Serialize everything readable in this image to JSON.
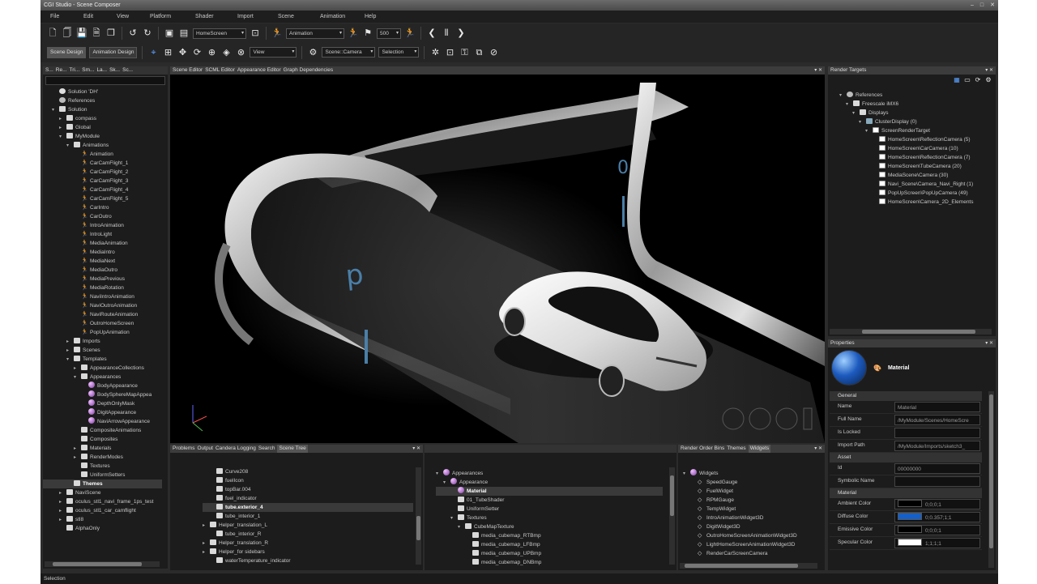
{
  "window": {
    "title": "CGI Studio - Scene Composer",
    "controls": [
      "–",
      "□",
      "✕"
    ]
  },
  "menu": [
    "File",
    "Edit",
    "View",
    "Platform",
    "Shader",
    "Import",
    "Scene",
    "Animation",
    "Help"
  ],
  "toolbar1": {
    "scene_select": "HomeScreen",
    "animation_select": "Animation",
    "speed_value": "500"
  },
  "toolbar2": {
    "tab_scene_design": "Scene Design",
    "tab_animation_design": "Animation Design",
    "view_select": "View",
    "camera_select": "Scene::Camera",
    "selection_select": "Selection"
  },
  "left_tabs": [
    "S...",
    "Re...",
    "Tri...",
    "Sm...",
    "La...",
    "Sk...",
    "Sc..."
  ],
  "solution_tree": [
    {
      "d": 1,
      "t": "",
      "i": "sol",
      "l": "Solution 'DH'"
    },
    {
      "d": 1,
      "t": "",
      "i": "ref",
      "l": "References"
    },
    {
      "d": 1,
      "t": "▾",
      "i": "sq",
      "l": "Solution"
    },
    {
      "d": 2,
      "t": "▸",
      "i": "sq",
      "l": "compass"
    },
    {
      "d": 2,
      "t": "▸",
      "i": "sq",
      "l": "Global"
    },
    {
      "d": 2,
      "t": "▾",
      "i": "sq",
      "l": "MyModule"
    },
    {
      "d": 3,
      "t": "▾",
      "i": "sq",
      "l": "Animations"
    },
    {
      "d": 4,
      "t": "",
      "i": "run",
      "l": "Animation"
    },
    {
      "d": 4,
      "t": "",
      "i": "run",
      "l": "CarCamFlight_1"
    },
    {
      "d": 4,
      "t": "",
      "i": "run",
      "l": "CarCamFlight_2"
    },
    {
      "d": 4,
      "t": "",
      "i": "run",
      "l": "CarCamFlight_3"
    },
    {
      "d": 4,
      "t": "",
      "i": "run",
      "l": "CarCamFlight_4"
    },
    {
      "d": 4,
      "t": "",
      "i": "run",
      "l": "CarCamFlight_5"
    },
    {
      "d": 4,
      "t": "",
      "i": "run",
      "l": "CarIntro"
    },
    {
      "d": 4,
      "t": "",
      "i": "run",
      "l": "CarOutro"
    },
    {
      "d": 4,
      "t": "",
      "i": "run",
      "l": "IntroAnimation"
    },
    {
      "d": 4,
      "t": "",
      "i": "run",
      "l": "IntroLight"
    },
    {
      "d": 4,
      "t": "",
      "i": "run",
      "l": "MediaAnimation"
    },
    {
      "d": 4,
      "t": "",
      "i": "run",
      "l": "MediaIntro"
    },
    {
      "d": 4,
      "t": "",
      "i": "run",
      "l": "MediaNext"
    },
    {
      "d": 4,
      "t": "",
      "i": "run",
      "l": "MediaOutro"
    },
    {
      "d": 4,
      "t": "",
      "i": "run",
      "l": "MediaPrevious"
    },
    {
      "d": 4,
      "t": "",
      "i": "run",
      "l": "MediaRotation"
    },
    {
      "d": 4,
      "t": "",
      "i": "run",
      "l": "NaviIntroAnimation"
    },
    {
      "d": 4,
      "t": "",
      "i": "run",
      "l": "NaviOutroAnimation"
    },
    {
      "d": 4,
      "t": "",
      "i": "run",
      "l": "NaviRouteAnimation"
    },
    {
      "d": 4,
      "t": "",
      "i": "run",
      "l": "OutroHomeScreen"
    },
    {
      "d": 4,
      "t": "",
      "i": "run",
      "l": "PopUpAnimation"
    },
    {
      "d": 3,
      "t": "▸",
      "i": "sq",
      "l": "Imports"
    },
    {
      "d": 3,
      "t": "▸",
      "i": "sq",
      "l": "Scenes"
    },
    {
      "d": 3,
      "t": "▾",
      "i": "sq",
      "l": "Templates"
    },
    {
      "d": 4,
      "t": "▸",
      "i": "sq",
      "l": "AppearanceCollections"
    },
    {
      "d": 4,
      "t": "▾",
      "i": "sq",
      "l": "Appearances"
    },
    {
      "d": 5,
      "t": "",
      "i": "sph",
      "l": "BodyAppearance"
    },
    {
      "d": 5,
      "t": "",
      "i": "sph",
      "l": "BodySphereMapAppea"
    },
    {
      "d": 5,
      "t": "",
      "i": "sph",
      "l": "DepthOnlyMask"
    },
    {
      "d": 5,
      "t": "",
      "i": "sph",
      "l": "DigitAppearance"
    },
    {
      "d": 5,
      "t": "",
      "i": "sph",
      "l": "NaviArrowAppearance"
    },
    {
      "d": 4,
      "t": "",
      "i": "sq",
      "l": "CompositeAnimations"
    },
    {
      "d": 4,
      "t": "",
      "i": "sq",
      "l": "Composites"
    },
    {
      "d": 4,
      "t": "▸",
      "i": "sq",
      "l": "Materials"
    },
    {
      "d": 4,
      "t": "▸",
      "i": "sq",
      "l": "RenderModes"
    },
    {
      "d": 4,
      "t": "",
      "i": "sq",
      "l": "Textures"
    },
    {
      "d": 4,
      "t": "",
      "i": "sq",
      "l": "UniformSetters"
    },
    {
      "d": 3,
      "t": "",
      "i": "sq",
      "l": "Themes",
      "hl": true
    },
    {
      "d": 2,
      "t": "▸",
      "i": "sq",
      "l": "NaviScene"
    },
    {
      "d": 2,
      "t": "▸",
      "i": "sq",
      "l": "oculus_stl1_navi_frame_1ps_test"
    },
    {
      "d": 2,
      "t": "▸",
      "i": "sq",
      "l": "oculus_stl1_car_camflight"
    },
    {
      "d": 2,
      "t": "▸",
      "i": "sq",
      "l": "stl8"
    },
    {
      "d": 2,
      "t": "",
      "i": "sq",
      "l": "AlphaOnly"
    }
  ],
  "editor_tabs": [
    "Scene Editor",
    "SCML Editor",
    "Appearance Editor",
    "Graph Dependencies"
  ],
  "viewport": {
    "glyph_p": "p",
    "glyph_d": "d",
    "glyph_o": "0"
  },
  "render_targets": {
    "title": "Render Targets",
    "tree": [
      {
        "d": 1,
        "t": "▾",
        "i": "ref",
        "l": "References"
      },
      {
        "d": 2,
        "t": "▾",
        "i": "sq",
        "l": "Freescale iMX6"
      },
      {
        "d": 3,
        "t": "▾",
        "i": "sq",
        "l": "Displays"
      },
      {
        "d": 4,
        "t": "▾",
        "i": "mon",
        "l": "ClusterDisplay (0)"
      },
      {
        "d": 5,
        "t": "▾",
        "i": "chk",
        "l": "ScreenRenderTarget"
      },
      {
        "d": 6,
        "t": "",
        "i": "chk",
        "l": "HomeScreen\\ReflectionCamera (5)"
      },
      {
        "d": 6,
        "t": "",
        "i": "chk",
        "l": "HomeScreen\\CarCamera (10)"
      },
      {
        "d": 6,
        "t": "",
        "i": "chk",
        "l": "HomeScreen\\ReflectionCamera (7)"
      },
      {
        "d": 6,
        "t": "",
        "i": "chk",
        "l": "HomeScreen\\TubeCamera (20)"
      },
      {
        "d": 6,
        "t": "",
        "i": "chk",
        "l": "MediaScene\\Camera (30)"
      },
      {
        "d": 6,
        "t": "",
        "i": "chk",
        "l": "Navi_Scene\\Camera_Navi_Right (1)"
      },
      {
        "d": 6,
        "t": "",
        "i": "chk",
        "l": "PopUpScreen\\PopUpCamera (49)"
      },
      {
        "d": 6,
        "t": "",
        "i": "chk",
        "l": "HomeScreen\\Camera_2D_Elements"
      }
    ]
  },
  "properties": {
    "title": "Properties",
    "header": "Material",
    "sections": [
      {
        "name": "General",
        "rows": [
          {
            "k": "Name",
            "v": "Material"
          },
          {
            "k": "Full Name",
            "v": "/MyModule/Scenes/HomeScre"
          },
          {
            "k": "Is Locked",
            "v": ""
          },
          {
            "k": "Import Path",
            "v": "/MyModule/Imports/sketch3_"
          }
        ]
      },
      {
        "name": "Asset",
        "rows": [
          {
            "k": "Id",
            "v": "00000000"
          },
          {
            "k": "Symbolic Name",
            "v": ""
          }
        ]
      },
      {
        "name": "Material",
        "rows": [
          {
            "k": "Ambient Color",
            "v": "0;0;0;1",
            "c": "#000000"
          },
          {
            "k": "Diffuse Color",
            "v": "0;0.357;1;1",
            "c": "#1560c8"
          },
          {
            "k": "Emissive Color",
            "v": "0;0;0;1",
            "c": "#000000"
          },
          {
            "k": "Specular Color",
            "v": "1;1;1;1",
            "c": "#ffffff"
          }
        ]
      }
    ]
  },
  "bottom_left_tabs": [
    "Problems",
    "Output",
    "Candera Logging",
    "Search",
    "Scene Tree"
  ],
  "scene_tree": [
    {
      "d": 1,
      "t": "",
      "i": "sq",
      "l": "Curve208"
    },
    {
      "d": 1,
      "t": "",
      "i": "sq",
      "l": "fuelIcon"
    },
    {
      "d": 1,
      "t": "",
      "i": "sq",
      "l": "topBar.004"
    },
    {
      "d": 1,
      "t": "",
      "i": "sq",
      "l": "fuel_indicator"
    },
    {
      "d": 1,
      "t": "",
      "i": "sq",
      "l": "tube.exterior_4",
      "hl": true
    },
    {
      "d": 1,
      "t": "",
      "i": "sq",
      "l": "tube_interior_1"
    },
    {
      "d": 0,
      "t": "▸",
      "i": "sq",
      "l": "Helper_translation_L"
    },
    {
      "d": 1,
      "t": "",
      "i": "sq",
      "l": "tube_interior_R"
    },
    {
      "d": 0,
      "t": "▸",
      "i": "sq",
      "l": "Helper_translation_R"
    },
    {
      "d": 0,
      "t": "▸",
      "i": "sq",
      "l": "Helper_for sidebars"
    },
    {
      "d": 1,
      "t": "",
      "i": "sq",
      "l": "waterTemperature_indicator"
    }
  ],
  "appearance_tree": [
    {
      "d": 0,
      "t": "▾",
      "i": "sph",
      "l": "Appearances"
    },
    {
      "d": 1,
      "t": "▾",
      "i": "sph",
      "l": "Appearance"
    },
    {
      "d": 2,
      "t": "",
      "i": "sph",
      "l": "Material",
      "hl": true
    },
    {
      "d": 2,
      "t": "",
      "i": "sq",
      "l": "01_TubeShader"
    },
    {
      "d": 2,
      "t": "",
      "i": "sq",
      "l": "UniformSetter"
    },
    {
      "d": 2,
      "t": "▾",
      "i": "sq",
      "l": "Textures"
    },
    {
      "d": 3,
      "t": "▾",
      "i": "sq",
      "l": "CubeMapTexture"
    },
    {
      "d": 4,
      "t": "",
      "i": "sq",
      "l": "media_cubemap_RTBmp"
    },
    {
      "d": 4,
      "t": "",
      "i": "sq",
      "l": "media_cubemap_LFBmp"
    },
    {
      "d": 4,
      "t": "",
      "i": "sq",
      "l": "media_cubemap_UPBmp"
    },
    {
      "d": 4,
      "t": "",
      "i": "sq",
      "l": "media_cubemap_DNBmp"
    }
  ],
  "bottom_right_tabs": [
    "Render Order Bins",
    "Themes",
    "Widgets"
  ],
  "widgets_tree": [
    {
      "d": 0,
      "t": "▾",
      "i": "sph",
      "l": "Widgets"
    },
    {
      "d": 1,
      "t": "",
      "i": "dia",
      "l": "SpeedGauge"
    },
    {
      "d": 1,
      "t": "",
      "i": "dia",
      "l": "FuelWidget"
    },
    {
      "d": 1,
      "t": "",
      "i": "dia",
      "l": "RPMGauge"
    },
    {
      "d": 1,
      "t": "",
      "i": "dia",
      "l": "TempWidget"
    },
    {
      "d": 1,
      "t": "",
      "i": "dia",
      "l": "IntroAnimationWidget3D"
    },
    {
      "d": 1,
      "t": "",
      "i": "dia",
      "l": "DigitWidget3D"
    },
    {
      "d": 1,
      "t": "",
      "i": "dia",
      "l": "OutroHomeScreenAnimationWidget3D"
    },
    {
      "d": 1,
      "t": "",
      "i": "dia",
      "l": "LightHomeScreenAnimationWidget3D"
    },
    {
      "d": 1,
      "t": "",
      "i": "dia",
      "l": "RenderCarScreenCamera"
    }
  ],
  "status": "Selection"
}
